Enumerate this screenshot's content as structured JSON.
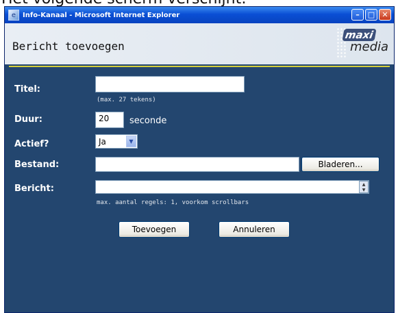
{
  "page_caption": "Het volgende scherm verschijnt:",
  "window": {
    "title": "Info-Kanaal - Microsoft Internet Explorer",
    "buttons": {
      "minimize": "–",
      "maximize": "□",
      "close": "✕"
    }
  },
  "header": {
    "title": "Bericht toevoegen",
    "logo_top": "maxi",
    "logo_bottom": "media"
  },
  "form": {
    "titel": {
      "label": "Titel:",
      "value": "",
      "hint": "(max. 27 tekens)"
    },
    "duur": {
      "label": "Duur:",
      "value": "20",
      "unit": "seconde"
    },
    "actief": {
      "label": "Actief?",
      "selected": "Ja"
    },
    "bestand": {
      "label": "Bestand:",
      "value": "",
      "browse_label": "Bladeren..."
    },
    "bericht": {
      "label": "Bericht:",
      "value": "",
      "hint": "max. aantal regels: 1, voorkom scrollbars"
    }
  },
  "actions": {
    "add_label": "Toevoegen",
    "cancel_label": "Annuleren"
  },
  "colors": {
    "panel": "#23466f",
    "accent_rule": "#d6d03c"
  }
}
